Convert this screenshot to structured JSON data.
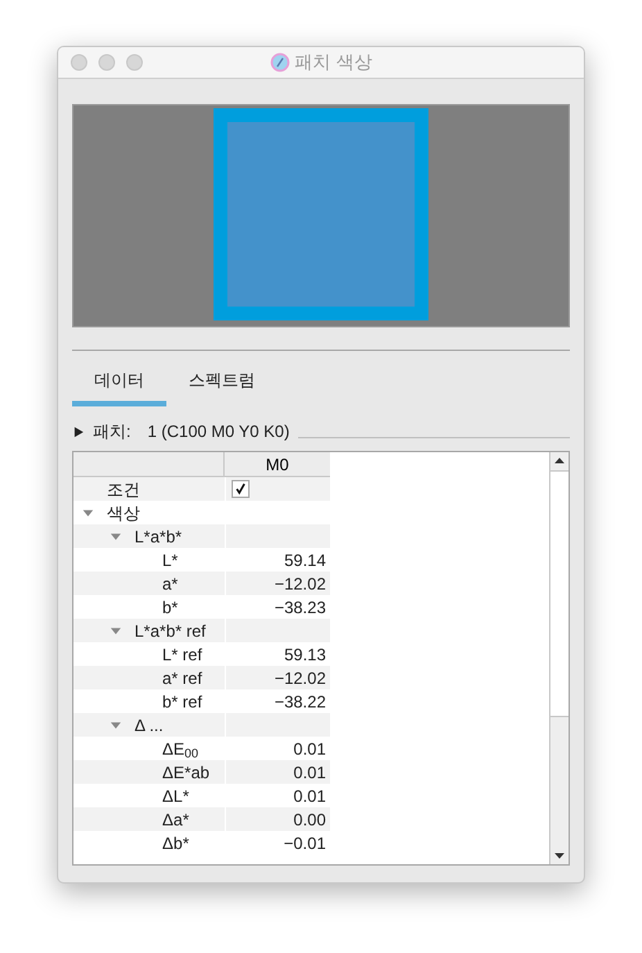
{
  "window": {
    "title": "패치 색상"
  },
  "tabs": [
    {
      "label": "데이터",
      "selected": true
    },
    {
      "label": "스펙트럼",
      "selected": false
    }
  ],
  "patch": {
    "expanded": false,
    "label": "패치:",
    "value": "1 (C100 M0 Y0 K0)"
  },
  "table": {
    "columns": [
      "M0"
    ],
    "rows": [
      {
        "name": "조건",
        "kind": "checkbox",
        "checked": true
      },
      {
        "name": "색상",
        "kind": "group",
        "expanded": true,
        "children": [
          {
            "name": "L*a*b*",
            "kind": "group",
            "expanded": true,
            "children": [
              {
                "name": "L*",
                "kind": "value",
                "value": "59.14"
              },
              {
                "name": "a*",
                "kind": "value",
                "value": "−12.02"
              },
              {
                "name": "b*",
                "kind": "value",
                "value": "−38.23"
              }
            ]
          },
          {
            "name": "L*a*b* ref",
            "kind": "group",
            "expanded": true,
            "children": [
              {
                "name": "L* ref",
                "kind": "value",
                "value": "59.13"
              },
              {
                "name": "a* ref",
                "kind": "value",
                "value": "−12.02"
              },
              {
                "name": "b* ref",
                "kind": "value",
                "value": "−38.22"
              }
            ]
          },
          {
            "name": "Δ ...",
            "kind": "group",
            "expanded": true,
            "children": [
              {
                "name": "ΔE$_{00}$",
                "kind": "value",
                "value": "0.01"
              },
              {
                "name": "ΔE*ab",
                "kind": "value",
                "value": "0.01"
              },
              {
                "name": "ΔL*",
                "kind": "value",
                "value": "0.01"
              },
              {
                "name": "Δa*",
                "kind": "value",
                "value": "0.00"
              },
              {
                "name": "Δb*",
                "kind": "value",
                "value": "−0.01"
              }
            ]
          }
        ]
      }
    ]
  }
}
